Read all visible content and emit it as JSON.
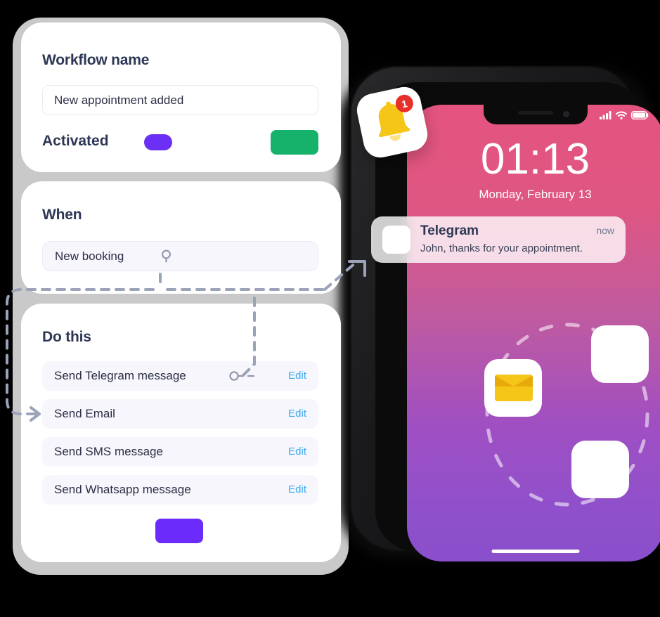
{
  "workflow_card": {
    "title": "Workflow name",
    "name_value": "New appointment added",
    "name_placeholder": "Workflow name",
    "activated_label": "Activated",
    "activated_on": true,
    "toggle_color": "#6b2ff5",
    "save_color": "#16b26c",
    "save_label": ""
  },
  "when_card": {
    "title": "When",
    "trigger": "New booking",
    "pin_icon": "map-pin-icon"
  },
  "do_this_card": {
    "title": "Do this",
    "edit_label": "Edit",
    "edit_color": "#3ba9f0",
    "add_button_color": "#6b2bfa",
    "add_button_label": "",
    "actions": [
      {
        "label": "Send Telegram message",
        "edit": "Edit",
        "has_node": true
      },
      {
        "label": "Send Email",
        "edit": "Edit",
        "has_node": false
      },
      {
        "label": "Send SMS message",
        "edit": "Edit",
        "has_node": false
      },
      {
        "label": "Send Whatsapp message",
        "edit": "Edit",
        "has_node": false
      }
    ]
  },
  "phone": {
    "status_bar": {
      "signal_icon": "cellular-signal-icon",
      "wifi_icon": "wifi-icon",
      "battery_icon": "battery-icon"
    },
    "lock_screen": {
      "time": "01:13",
      "date": "Monday, February 13"
    },
    "notification": {
      "app": "Telegram",
      "time": "now",
      "message": "John, thanks for your appointment.",
      "app_icon": "telegram-app-icon"
    },
    "home_apps": [
      {
        "name": "app-icon-top",
        "glyph": ""
      },
      {
        "name": "app-icon-mail",
        "glyph": "envelope-icon"
      },
      {
        "name": "app-icon-bottom",
        "glyph": ""
      }
    ],
    "screen_gradient": [
      "#e4547f",
      "#8a4fcb"
    ],
    "home_indicator": true
  },
  "bell_badge": {
    "icon": "bell-icon",
    "count": "1",
    "badge_color": "#e8302a",
    "bell_color": "#f5c518"
  },
  "connectors": {
    "color": "#9aa3b8",
    "style": "dashed"
  }
}
